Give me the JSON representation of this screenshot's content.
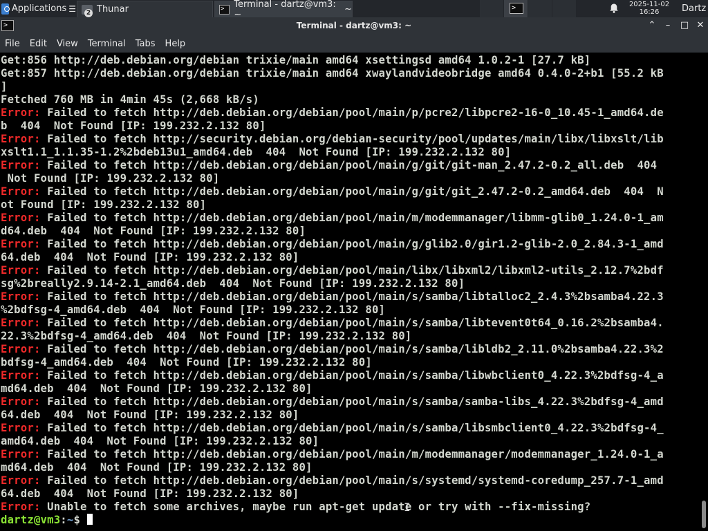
{
  "panel": {
    "apps_label": "Applications",
    "tasks": [
      {
        "label": "Thunar",
        "badge": "2"
      },
      {
        "label": "Terminal - dartz@vm3: ~"
      }
    ],
    "clock": {
      "date": "2025-11-02",
      "time": "16:26"
    },
    "user": "Dartz"
  },
  "window": {
    "title": "Terminal - dartz@vm3: ~",
    "icon_glyph": ">_"
  },
  "menu": [
    "File",
    "Edit",
    "View",
    "Terminal",
    "Tabs",
    "Help"
  ],
  "terminal": {
    "lines": [
      {
        "text": "Get:856 http://deb.debian.org/debian trixie/main amd64 xsettingsd amd64 1.0.2-1 [27.7 kB]"
      },
      {
        "text": "Get:857 http://deb.debian.org/debian trixie/main amd64 xwaylandvideobridge amd64 0.4.0-2+b1 [55.2 kB"
      },
      {
        "text": "]"
      },
      {
        "text": "Fetched 760 MB in 4min 45s (2,668 kB/s)"
      },
      {
        "prefix": "Error:",
        "text": " Failed to fetch http://deb.debian.org/debian/pool/main/p/pcre2/libpcre2-16-0_10.45-1_amd64.de"
      },
      {
        "text": "b  404  Not Found [IP: 199.232.2.132 80]"
      },
      {
        "prefix": "Error:",
        "text": " Failed to fetch http://security.debian.org/debian-security/pool/updates/main/libx/libxslt/lib"
      },
      {
        "text": "xslt1.1_1.1.35-1.2%2bdeb13u1_amd64.deb  404  Not Found [IP: 199.232.2.132 80]"
      },
      {
        "prefix": "Error:",
        "text": " Failed to fetch http://deb.debian.org/debian/pool/main/g/git/git-man_2.47.2-0.2_all.deb  404"
      },
      {
        "text": " Not Found [IP: 199.232.2.132 80]"
      },
      {
        "prefix": "Error:",
        "text": " Failed to fetch http://deb.debian.org/debian/pool/main/g/git/git_2.47.2-0.2_amd64.deb  404  N"
      },
      {
        "text": "ot Found [IP: 199.232.2.132 80]"
      },
      {
        "prefix": "Error:",
        "text": " Failed to fetch http://deb.debian.org/debian/pool/main/m/modemmanager/libmm-glib0_1.24.0-1_am"
      },
      {
        "text": "d64.deb  404  Not Found [IP: 199.232.2.132 80]"
      },
      {
        "prefix": "Error:",
        "text": " Failed to fetch http://deb.debian.org/debian/pool/main/g/glib2.0/gir1.2-glib-2.0_2.84.3-1_amd"
      },
      {
        "text": "64.deb  404  Not Found [IP: 199.232.2.132 80]"
      },
      {
        "prefix": "Error:",
        "text": " Failed to fetch http://deb.debian.org/debian/pool/main/libx/libxml2/libxml2-utils_2.12.7%2bdf"
      },
      {
        "text": "sg%2breally2.9.14-2.1_amd64.deb  404  Not Found [IP: 199.232.2.132 80]"
      },
      {
        "prefix": "Error:",
        "text": " Failed to fetch http://deb.debian.org/debian/pool/main/s/samba/libtalloc2_2.4.3%2bsamba4.22.3"
      },
      {
        "text": "%2bdfsg-4_amd64.deb  404  Not Found [IP: 199.232.2.132 80]"
      },
      {
        "prefix": "Error:",
        "text": " Failed to fetch http://deb.debian.org/debian/pool/main/s/samba/libtevent0t64_0.16.2%2bsamba4."
      },
      {
        "text": "22.3%2bdfsg-4_amd64.deb  404  Not Found [IP: 199.232.2.132 80]"
      },
      {
        "prefix": "Error:",
        "text": " Failed to fetch http://deb.debian.org/debian/pool/main/s/samba/libldb2_2.11.0%2bsamba4.22.3%2"
      },
      {
        "text": "bdfsg-4_amd64.deb  404  Not Found [IP: 199.232.2.132 80]"
      },
      {
        "prefix": "Error:",
        "text": " Failed to fetch http://deb.debian.org/debian/pool/main/s/samba/libwbclient0_4.22.3%2bdfsg-4_a"
      },
      {
        "text": "md64.deb  404  Not Found [IP: 199.232.2.132 80]"
      },
      {
        "prefix": "Error:",
        "text": " Failed to fetch http://deb.debian.org/debian/pool/main/s/samba/samba-libs_4.22.3%2bdfsg-4_amd"
      },
      {
        "text": "64.deb  404  Not Found [IP: 199.232.2.132 80]"
      },
      {
        "prefix": "Error:",
        "text": " Failed to fetch http://deb.debian.org/debian/pool/main/s/samba/libsmbclient0_4.22.3%2bdfsg-4_"
      },
      {
        "text": "amd64.deb  404  Not Found [IP: 199.232.2.132 80]"
      },
      {
        "prefix": "Error:",
        "text": " Failed to fetch http://deb.debian.org/debian/pool/main/m/modemmanager/modemmanager_1.24.0-1_a"
      },
      {
        "text": "md64.deb  404  Not Found [IP: 199.232.2.132 80]"
      },
      {
        "prefix": "Error:",
        "text": " Failed to fetch http://deb.debian.org/debian/pool/main/s/systemd/systemd-coredump_257.7-1_amd"
      },
      {
        "text": "64.deb  404  Not Found [IP: 199.232.2.132 80]"
      },
      {
        "prefix": "Error:",
        "text": " Unable to fetch some archives, maybe run apt-get update or try with --fix-missing?"
      }
    ],
    "prompt": {
      "user_host": "dartz@vm3",
      "sep": ":",
      "path": "~",
      "symbol": "$ "
    }
  },
  "colors": {
    "error": "#ef2929",
    "prompt_user": "#8ae234",
    "prompt_path": "#729fcf",
    "text": "#d3d7cf",
    "background": "#000000"
  }
}
